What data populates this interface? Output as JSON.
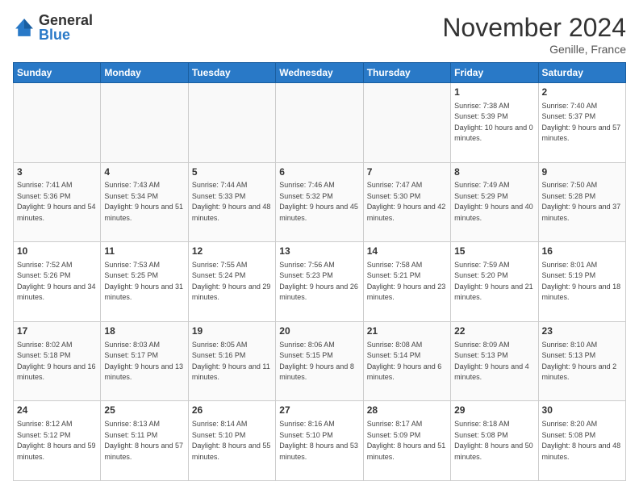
{
  "logo": {
    "general": "General",
    "blue": "Blue"
  },
  "header": {
    "month": "November 2024",
    "location": "Genille, France"
  },
  "days_of_week": [
    "Sunday",
    "Monday",
    "Tuesday",
    "Wednesday",
    "Thursday",
    "Friday",
    "Saturday"
  ],
  "weeks": [
    [
      {
        "day": "",
        "info": ""
      },
      {
        "day": "",
        "info": ""
      },
      {
        "day": "",
        "info": ""
      },
      {
        "day": "",
        "info": ""
      },
      {
        "day": "",
        "info": ""
      },
      {
        "day": "1",
        "info": "Sunrise: 7:38 AM\nSunset: 5:39 PM\nDaylight: 10 hours and 0 minutes."
      },
      {
        "day": "2",
        "info": "Sunrise: 7:40 AM\nSunset: 5:37 PM\nDaylight: 9 hours and 57 minutes."
      }
    ],
    [
      {
        "day": "3",
        "info": "Sunrise: 7:41 AM\nSunset: 5:36 PM\nDaylight: 9 hours and 54 minutes."
      },
      {
        "day": "4",
        "info": "Sunrise: 7:43 AM\nSunset: 5:34 PM\nDaylight: 9 hours and 51 minutes."
      },
      {
        "day": "5",
        "info": "Sunrise: 7:44 AM\nSunset: 5:33 PM\nDaylight: 9 hours and 48 minutes."
      },
      {
        "day": "6",
        "info": "Sunrise: 7:46 AM\nSunset: 5:32 PM\nDaylight: 9 hours and 45 minutes."
      },
      {
        "day": "7",
        "info": "Sunrise: 7:47 AM\nSunset: 5:30 PM\nDaylight: 9 hours and 42 minutes."
      },
      {
        "day": "8",
        "info": "Sunrise: 7:49 AM\nSunset: 5:29 PM\nDaylight: 9 hours and 40 minutes."
      },
      {
        "day": "9",
        "info": "Sunrise: 7:50 AM\nSunset: 5:28 PM\nDaylight: 9 hours and 37 minutes."
      }
    ],
    [
      {
        "day": "10",
        "info": "Sunrise: 7:52 AM\nSunset: 5:26 PM\nDaylight: 9 hours and 34 minutes."
      },
      {
        "day": "11",
        "info": "Sunrise: 7:53 AM\nSunset: 5:25 PM\nDaylight: 9 hours and 31 minutes."
      },
      {
        "day": "12",
        "info": "Sunrise: 7:55 AM\nSunset: 5:24 PM\nDaylight: 9 hours and 29 minutes."
      },
      {
        "day": "13",
        "info": "Sunrise: 7:56 AM\nSunset: 5:23 PM\nDaylight: 9 hours and 26 minutes."
      },
      {
        "day": "14",
        "info": "Sunrise: 7:58 AM\nSunset: 5:21 PM\nDaylight: 9 hours and 23 minutes."
      },
      {
        "day": "15",
        "info": "Sunrise: 7:59 AM\nSunset: 5:20 PM\nDaylight: 9 hours and 21 minutes."
      },
      {
        "day": "16",
        "info": "Sunrise: 8:01 AM\nSunset: 5:19 PM\nDaylight: 9 hours and 18 minutes."
      }
    ],
    [
      {
        "day": "17",
        "info": "Sunrise: 8:02 AM\nSunset: 5:18 PM\nDaylight: 9 hours and 16 minutes."
      },
      {
        "day": "18",
        "info": "Sunrise: 8:03 AM\nSunset: 5:17 PM\nDaylight: 9 hours and 13 minutes."
      },
      {
        "day": "19",
        "info": "Sunrise: 8:05 AM\nSunset: 5:16 PM\nDaylight: 9 hours and 11 minutes."
      },
      {
        "day": "20",
        "info": "Sunrise: 8:06 AM\nSunset: 5:15 PM\nDaylight: 9 hours and 8 minutes."
      },
      {
        "day": "21",
        "info": "Sunrise: 8:08 AM\nSunset: 5:14 PM\nDaylight: 9 hours and 6 minutes."
      },
      {
        "day": "22",
        "info": "Sunrise: 8:09 AM\nSunset: 5:13 PM\nDaylight: 9 hours and 4 minutes."
      },
      {
        "day": "23",
        "info": "Sunrise: 8:10 AM\nSunset: 5:13 PM\nDaylight: 9 hours and 2 minutes."
      }
    ],
    [
      {
        "day": "24",
        "info": "Sunrise: 8:12 AM\nSunset: 5:12 PM\nDaylight: 8 hours and 59 minutes."
      },
      {
        "day": "25",
        "info": "Sunrise: 8:13 AM\nSunset: 5:11 PM\nDaylight: 8 hours and 57 minutes."
      },
      {
        "day": "26",
        "info": "Sunrise: 8:14 AM\nSunset: 5:10 PM\nDaylight: 8 hours and 55 minutes."
      },
      {
        "day": "27",
        "info": "Sunrise: 8:16 AM\nSunset: 5:10 PM\nDaylight: 8 hours and 53 minutes."
      },
      {
        "day": "28",
        "info": "Sunrise: 8:17 AM\nSunset: 5:09 PM\nDaylight: 8 hours and 51 minutes."
      },
      {
        "day": "29",
        "info": "Sunrise: 8:18 AM\nSunset: 5:08 PM\nDaylight: 8 hours and 50 minutes."
      },
      {
        "day": "30",
        "info": "Sunrise: 8:20 AM\nSunset: 5:08 PM\nDaylight: 8 hours and 48 minutes."
      }
    ]
  ]
}
